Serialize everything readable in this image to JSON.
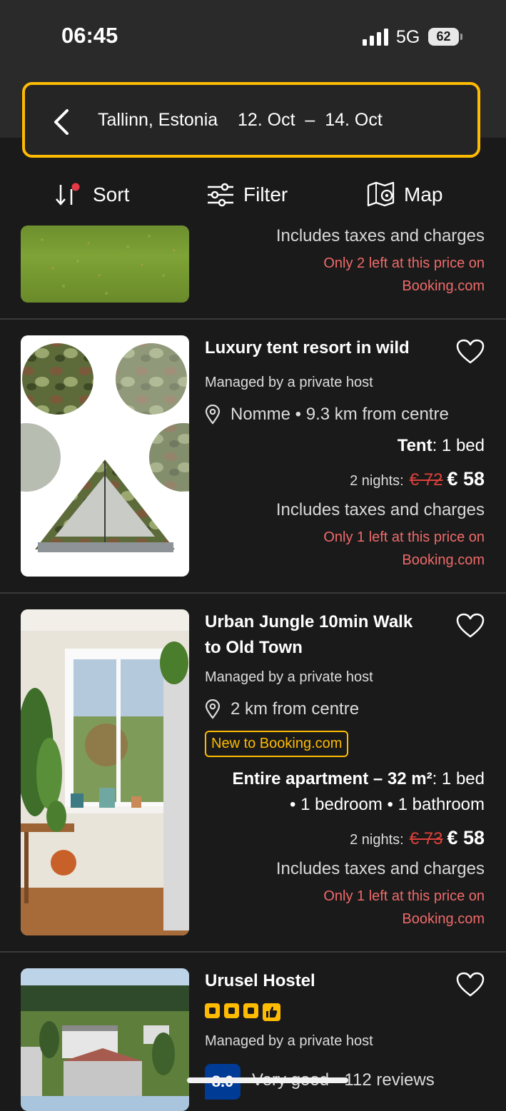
{
  "status_bar": {
    "time": "06:45",
    "network": "5G",
    "battery": "62"
  },
  "search_summary": {
    "location": "Tallinn, Estonia",
    "dates": "12. Oct  –  14. Oct"
  },
  "toolbar": {
    "sort": "Sort",
    "filter": "Filter",
    "map": "Map"
  },
  "partial_listing": {
    "taxes": "Includes taxes and charges",
    "urgency_line1": "Only 2 left at this price on",
    "urgency_line2": "Booking.com"
  },
  "listings": [
    {
      "title": "Luxury tent resort in wild",
      "managed_by": "Managed by a private host",
      "location": "Nomme • 9.3 km from centre",
      "unit_type": "Tent",
      "unit_detail": ": 1 bed",
      "nights": "2 nights:",
      "old_price": "€ 72",
      "new_price": "€ 58",
      "taxes": "Includes taxes and charges",
      "urgency_line1": "Only 1 left at this price on",
      "urgency_line2": "Booking.com"
    },
    {
      "title_line1": "Urban Jungle 10min Walk",
      "title_line2": "to Old Town",
      "managed_by": "Managed by a private host",
      "location": "2 km from centre",
      "badge": "New to Booking.com",
      "unit_type": "Entire apartment – 32 m²",
      "unit_detail": ": 1 bed",
      "unit_detail2": "• 1 bedroom • 1 bathroom",
      "nights": "2 nights:",
      "old_price": "€ 73",
      "new_price": "€ 58",
      "taxes": "Includes taxes and charges",
      "urgency_line1": "Only 1 left at this price on",
      "urgency_line2": "Booking.com"
    },
    {
      "title": "Urusel Hostel",
      "star_rating": 3,
      "managed_by": "Managed by a private host",
      "score": "8.0",
      "score_word": "Very good",
      "reviews": "· 112 reviews"
    }
  ],
  "colors": {
    "accent": "#febb02",
    "urgency": "#ef6a6a",
    "strike": "#e0403a",
    "score_bg": "#003b95"
  }
}
